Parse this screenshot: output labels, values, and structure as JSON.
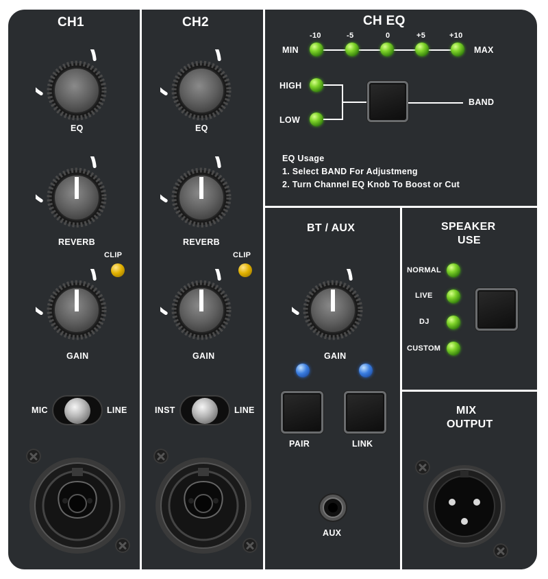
{
  "ch1": {
    "title": "CH1",
    "eq_label": "EQ",
    "reverb_label": "REVERB",
    "clip_label": "CLIP",
    "gain_label": "GAIN",
    "switch_left": "MIC",
    "switch_right": "LINE"
  },
  "ch2": {
    "title": "CH2",
    "eq_label": "EQ",
    "reverb_label": "REVERB",
    "clip_label": "CLIP",
    "gain_label": "GAIN",
    "switch_left": "INST",
    "switch_right": "LINE"
  },
  "ch_eq": {
    "title": "CH EQ",
    "scale_min": "MIN",
    "scale_max": "MAX",
    "scale_values": [
      "-10",
      "-5",
      "0",
      "+5",
      "+10"
    ],
    "high_label": "HIGH",
    "low_label": "LOW",
    "band_label": "BAND",
    "usage_title": "EQ Usage",
    "usage_step1": "1. Select BAND For Adjustmeng",
    "usage_step2": "2. Turn Channel EQ Knob To Boost or Cut"
  },
  "bt_aux": {
    "title": "BT / AUX",
    "gain_label": "GAIN",
    "pair_label": "PAIR",
    "link_label": "LINK",
    "aux_label": "AUX"
  },
  "speaker_use": {
    "title_line1": "SPEAKER",
    "title_line2": "USE",
    "modes": [
      "NORMAL",
      "LIVE",
      "DJ",
      "CUSTOM"
    ]
  },
  "mix_output": {
    "title_line1": "MIX",
    "title_line2": "OUTPUT"
  },
  "colors": {
    "panel": "#2a2d30",
    "led_green": "#7fd32a",
    "led_yellow": "#e0b000",
    "led_blue": "#3a7de0"
  }
}
